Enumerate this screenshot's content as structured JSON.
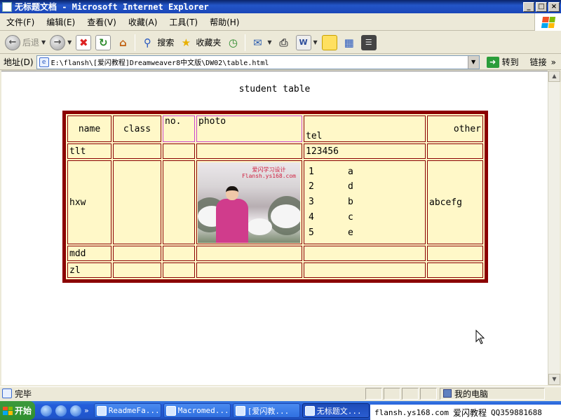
{
  "window": {
    "title": "无标题文档 - Microsoft Internet Explorer",
    "controls": [
      "_",
      "□",
      "×"
    ]
  },
  "menu": [
    "文件(F)",
    "编辑(E)",
    "查看(V)",
    "收藏(A)",
    "工具(T)",
    "帮助(H)"
  ],
  "toolbar": {
    "back_label": "后退",
    "search_label": "搜索",
    "favorites_label": "收藏夹"
  },
  "address": {
    "label": "地址(D)",
    "value": "E:\\flansh\\[爱闪教程]Dreamweaver8中文版\\DW02\\table.html",
    "go_label": "转到",
    "links_label": "链接",
    "more": "»"
  },
  "page": {
    "heading": "student table",
    "table": {
      "headers": {
        "name": "name",
        "class": "class",
        "no": "no.",
        "photo": "photo",
        "tel": "tel",
        "other": "other"
      },
      "rows": [
        {
          "name": "tlt",
          "tel": "123456",
          "other": ""
        },
        {
          "name": "hxw",
          "other": "abcefg",
          "tel_list": [
            {
              "n": "1",
              "v": "a"
            },
            {
              "n": "2",
              "v": "d"
            },
            {
              "n": "3",
              "v": "b"
            },
            {
              "n": "4",
              "v": "c"
            },
            {
              "n": "5",
              "v": "e"
            }
          ],
          "photo_watermark": [
            "爱闪学习设计",
            "Flansh.ys168.com"
          ]
        },
        {
          "name": "mdd"
        },
        {
          "name": "zl"
        }
      ]
    }
  },
  "status": {
    "text": "完毕",
    "zone": "我的电脑"
  },
  "taskbar": {
    "start_label": "开始",
    "more": "»",
    "tasks": [
      "ReadmeFa...",
      "Macromed...",
      "[爱闪教...",
      "无标题文..."
    ],
    "overlay_site": "flansh.ys168.com",
    "overlay_brand": "爱闪教程",
    "overlay_qq": "QQ359881688"
  }
}
